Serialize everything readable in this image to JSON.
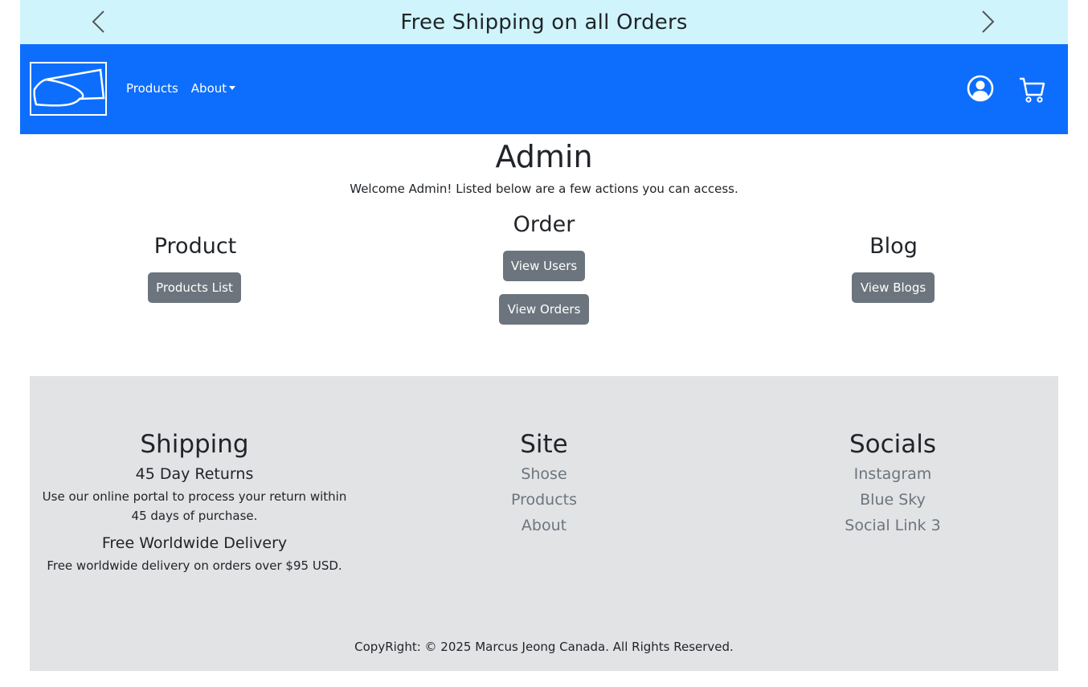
{
  "banner": {
    "text": "Free Shipping on all Orders",
    "prev_icon": "chevron-left-icon",
    "next_icon": "chevron-right-icon",
    "background": "#cff4fc"
  },
  "navbar": {
    "background": "#0d6efd",
    "brand_icon": "shoe-logo-icon",
    "links": [
      {
        "label": "Products"
      },
      {
        "label": "About",
        "has_dropdown": true
      }
    ],
    "user_icon": "user-circle-icon",
    "cart_icon": "cart-icon"
  },
  "admin": {
    "title": "Admin",
    "welcome": "Welcome Admin! Listed below are a few actions you can access.",
    "sections": {
      "product": {
        "heading": "Product",
        "buttons": [
          "Products List"
        ]
      },
      "order": {
        "heading": "Order",
        "buttons": [
          "View Users",
          "View Orders"
        ]
      },
      "blog": {
        "heading": "Blog",
        "buttons": [
          "View Blogs"
        ]
      }
    },
    "button_color": "#6c757d"
  },
  "footer": {
    "background": "#e2e3e5",
    "shipping": {
      "heading": "Shipping",
      "items": [
        {
          "title": "45 Day Returns",
          "text": "Use our online portal to process your return within 45 days of purchase."
        },
        {
          "title": "Free Worldwide Delivery",
          "text": "Free worldwide delivery on orders over $95 USD."
        }
      ]
    },
    "site": {
      "heading": "Site",
      "links": [
        "Shose",
        "Products",
        "About"
      ]
    },
    "socials": {
      "heading": "Socials",
      "links": [
        "Instagram",
        "Blue Sky",
        "Social Link 3"
      ]
    },
    "copyright": "CopyRight: © 2025 Marcus Jeong Canada. All Rights Reserved."
  }
}
